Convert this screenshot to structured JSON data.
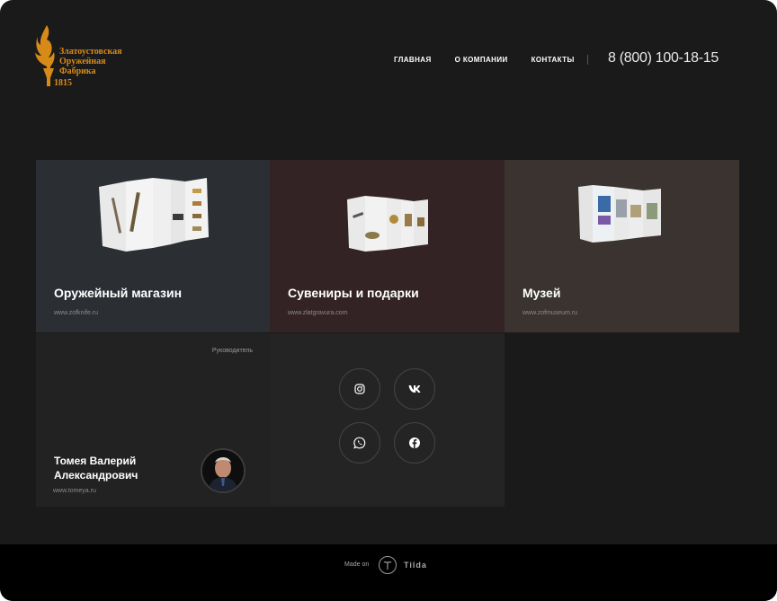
{
  "logo": {
    "line1": "Златоустовская",
    "line2": "Оружейная",
    "line3": "Фабрика",
    "year": "1815"
  },
  "nav": {
    "items": [
      "ГЛАВНАЯ",
      "О КОМПАНИИ",
      "КОНТАКТЫ"
    ],
    "phone": "8 (800) 100-18-15"
  },
  "cards": [
    {
      "title": "Оружейный магазин",
      "url": "www.zofknife.ru"
    },
    {
      "title": "Сувениры и подарки",
      "url": "www.zlatgravura.com"
    },
    {
      "title": "Музей",
      "url": "www.zofmuseum.ru"
    }
  ],
  "head": {
    "role": "Руководитель",
    "name": "Томея Валерий Александрович",
    "url": "www.tomeya.ru"
  },
  "social": [
    "instagram-icon",
    "vk-icon",
    "whatsapp-icon",
    "facebook-icon"
  ],
  "footer": {
    "made_on": "Made on",
    "brand": "Tilda"
  },
  "colors": {
    "background": "#1b1a1a",
    "logo_accent": "#d88a18",
    "card_shop": "#2b2f33",
    "card_souvenirs": "#342324",
    "card_museum": "#3a332f"
  }
}
